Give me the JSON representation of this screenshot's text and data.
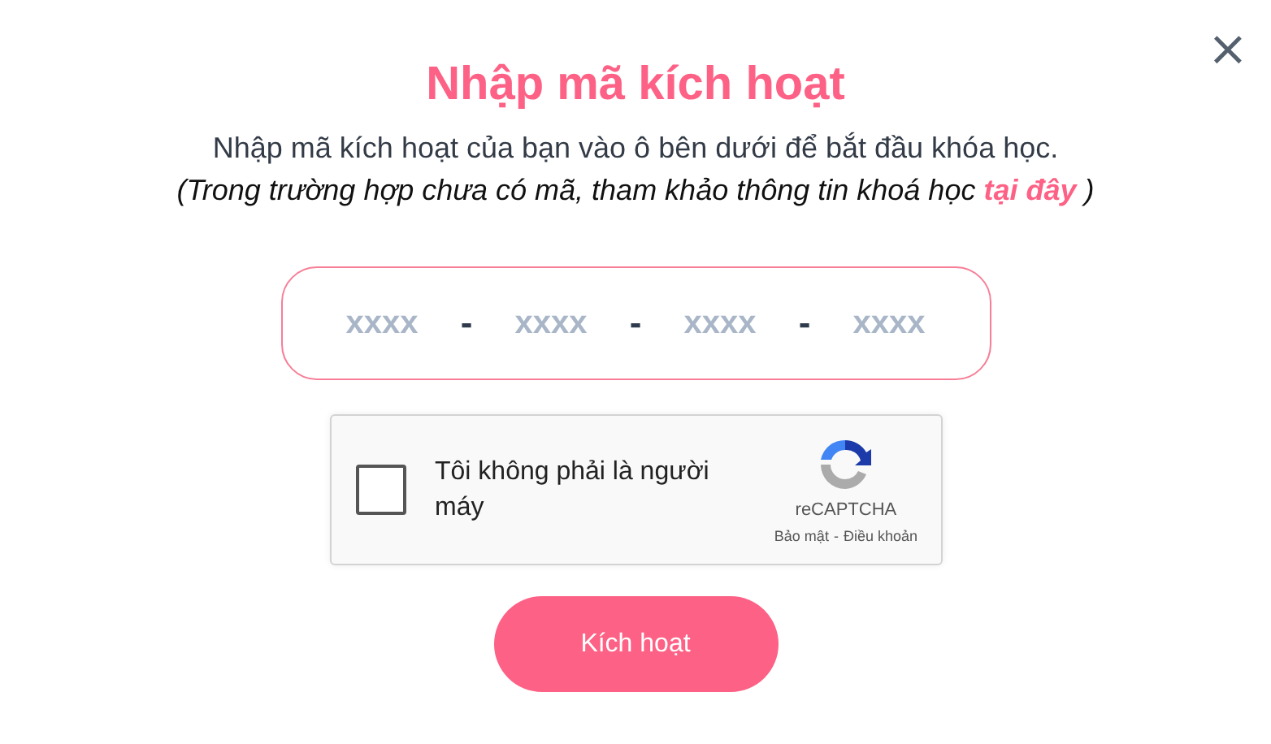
{
  "close_label": "×",
  "title": "Nhập mã kích hoạt",
  "description": "Nhập mã kích hoạt của bạn vào ô bên dưới để bắt đầu khóa học.",
  "note": {
    "before": "(Trong trường hợp chưa có mã, tham khảo thông tin khoá học",
    "link": "tại đây",
    "after": ")"
  },
  "code_fields": [
    {
      "placeholder": "xxxx"
    },
    {
      "placeholder": "xxxx"
    },
    {
      "placeholder": "xxxx"
    },
    {
      "placeholder": "xxxx"
    }
  ],
  "separator": "-",
  "captcha": {
    "checked": false,
    "label": "Tôi không phải là người máy",
    "brand": "reCAPTCHA",
    "privacy": "Bảo mật",
    "separator": "-",
    "terms": "Điều khoản"
  },
  "submit_button": "Kích hoạt"
}
